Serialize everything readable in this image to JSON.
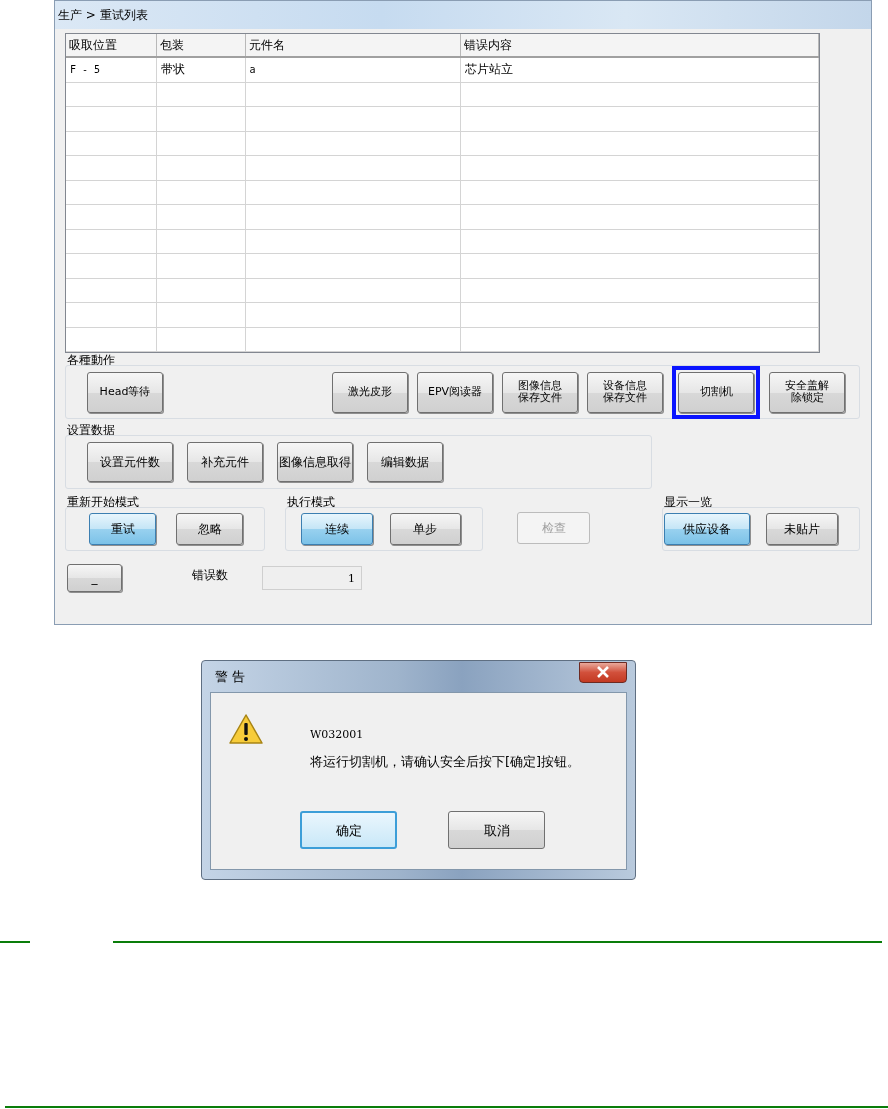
{
  "window": {
    "breadcrumb": "生产 > 重试列表"
  },
  "table": {
    "columns": [
      "吸取位置",
      "包装",
      "元件名",
      "错误内容"
    ],
    "rows": [
      [
        "F - 5",
        "带状",
        "a",
        "芯片站立"
      ]
    ]
  },
  "actions": {
    "title": "各種動作",
    "buttons": [
      {
        "label": "Head等待",
        "highlighted": false
      },
      {
        "label": "激光皮形",
        "highlighted": false
      },
      {
        "label": "EPV阅读器",
        "highlighted": false
      },
      {
        "label": "图像信息保存文件",
        "highlighted": false
      },
      {
        "label": "设备信息保存文件",
        "highlighted": false
      },
      {
        "label": "切割机",
        "highlighted": true
      },
      {
        "label": "安全盖解除锁定",
        "highlighted": false
      }
    ]
  },
  "setup_data": {
    "title": "设置数据",
    "buttons": [
      "设置元件数",
      "补充元件",
      "图像信息取得",
      "编辑数据"
    ]
  },
  "restart_mode": {
    "title": "重新开始模式",
    "options": [
      {
        "label": "重试",
        "selected": true
      },
      {
        "label": "忽略",
        "selected": false
      }
    ]
  },
  "exec_mode": {
    "title": "执行模式",
    "options": [
      {
        "label": "连续",
        "selected": true
      },
      {
        "label": "单步",
        "selected": false
      }
    ]
  },
  "check_button": {
    "label": "检查",
    "disabled": true
  },
  "display_list": {
    "title": "显示一览",
    "options": [
      {
        "label": "供应设备",
        "selected": true
      },
      {
        "label": "未贴片",
        "selected": false
      }
    ]
  },
  "minimize_button": "_",
  "error_count": {
    "label": "错误数",
    "value": "1"
  },
  "dialog": {
    "title": "警 告",
    "code": "W032001",
    "message": "将运行切割机，请确认安全后按下[确定]按钮。",
    "buttons": [
      {
        "label": "确定",
        "default": true
      },
      {
        "label": "取消",
        "default": false
      }
    ]
  }
}
